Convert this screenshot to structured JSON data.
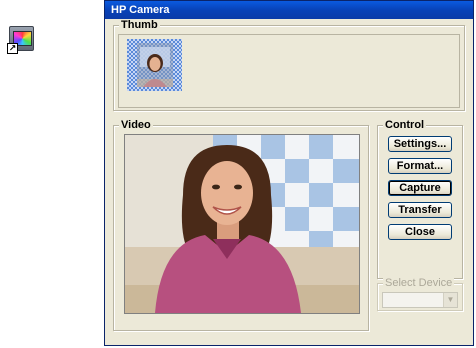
{
  "window": {
    "title": "HP Camera"
  },
  "groups": {
    "thumb_label": "Thumb",
    "video_label": "Video",
    "control_label": "Control",
    "device_label": "Select Device"
  },
  "buttons": {
    "settings": "Settings...",
    "format": "Format...",
    "capture": "Capture",
    "transfer": "Transfer",
    "close": "Close"
  },
  "device_select": {
    "value": "",
    "enabled": false
  },
  "desktop": {
    "shortcut_icon": "hp-camera-shortcut-icon"
  },
  "colors": {
    "titlebar": "#0a4fd0",
    "window_bg": "#ece9d8",
    "disabled_text": "#aca899"
  }
}
